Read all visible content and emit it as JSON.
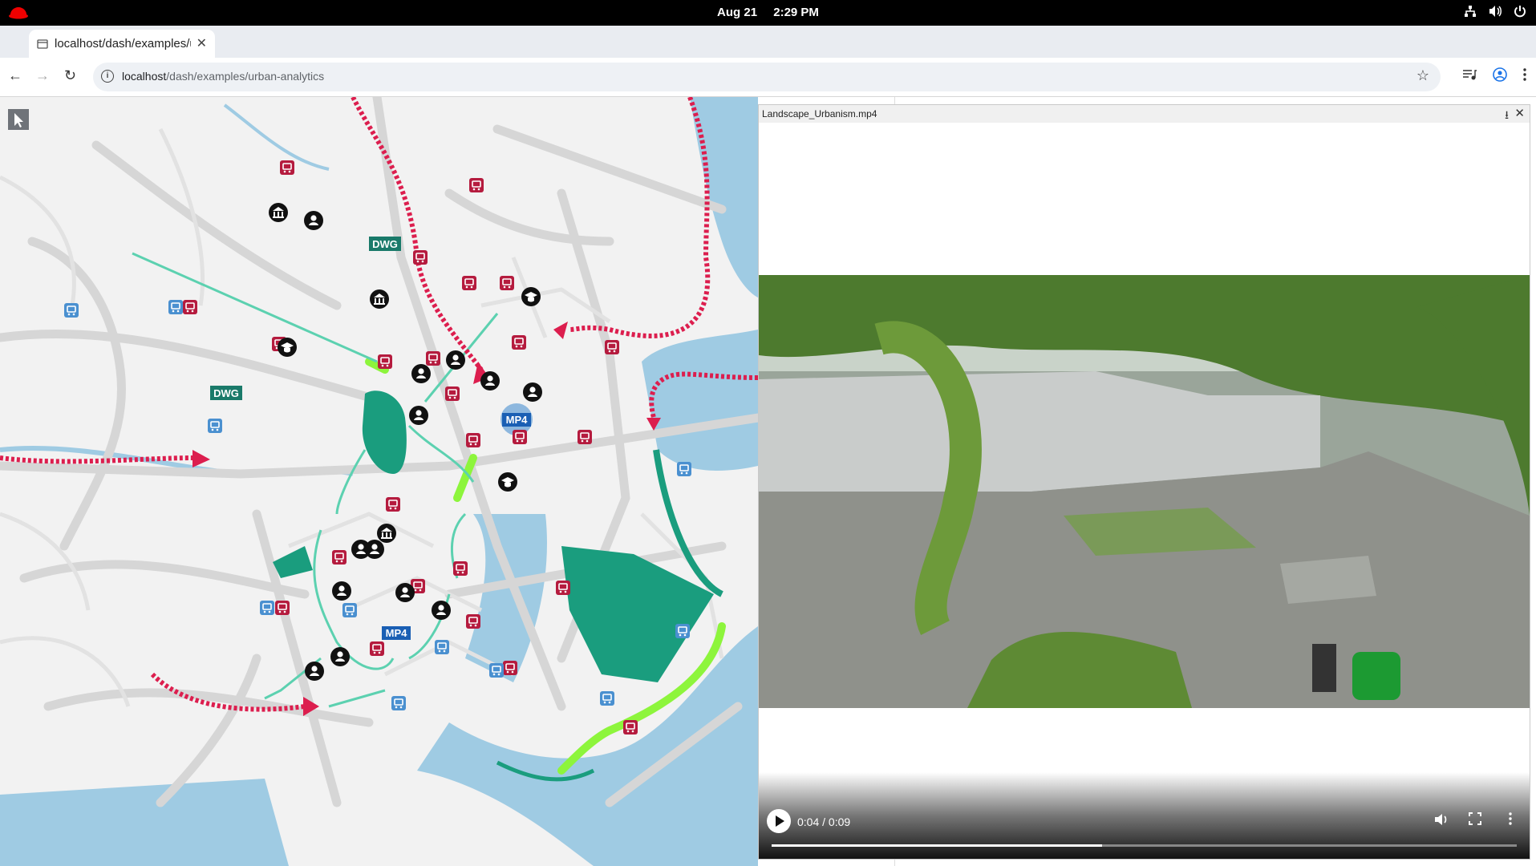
{
  "system": {
    "date": "Aug 21",
    "time": "2:29 PM"
  },
  "browser": {
    "tab_title": "localhost/dash/examples/urban-analytics",
    "url_host": "localhost",
    "url_path": "/dash/examples/urban-analytics",
    "new_tab_label": "+"
  },
  "map": {
    "labels": {
      "dwg1": "DWG",
      "dwg2": "DWG",
      "mp4a": "MP4",
      "mp4b": "MP4"
    },
    "colors": {
      "water": "#9fcbe3",
      "green": "#1a9d7e",
      "arrow": "#dc1e4e",
      "bus_red": "#b51b3e",
      "bus_blue": "#4a90d0",
      "lime": "#8df53c",
      "teal_arrow": "#5cd1b0"
    },
    "icons": [
      "bus-stop-icon",
      "metro-stop-icon",
      "museum-icon",
      "school-icon",
      "person-icon"
    ]
  },
  "viewer": {
    "filename": "Landscape_Urbanism.mp4",
    "time_display": "0:04 / 0:09",
    "progress": 0.444
  }
}
